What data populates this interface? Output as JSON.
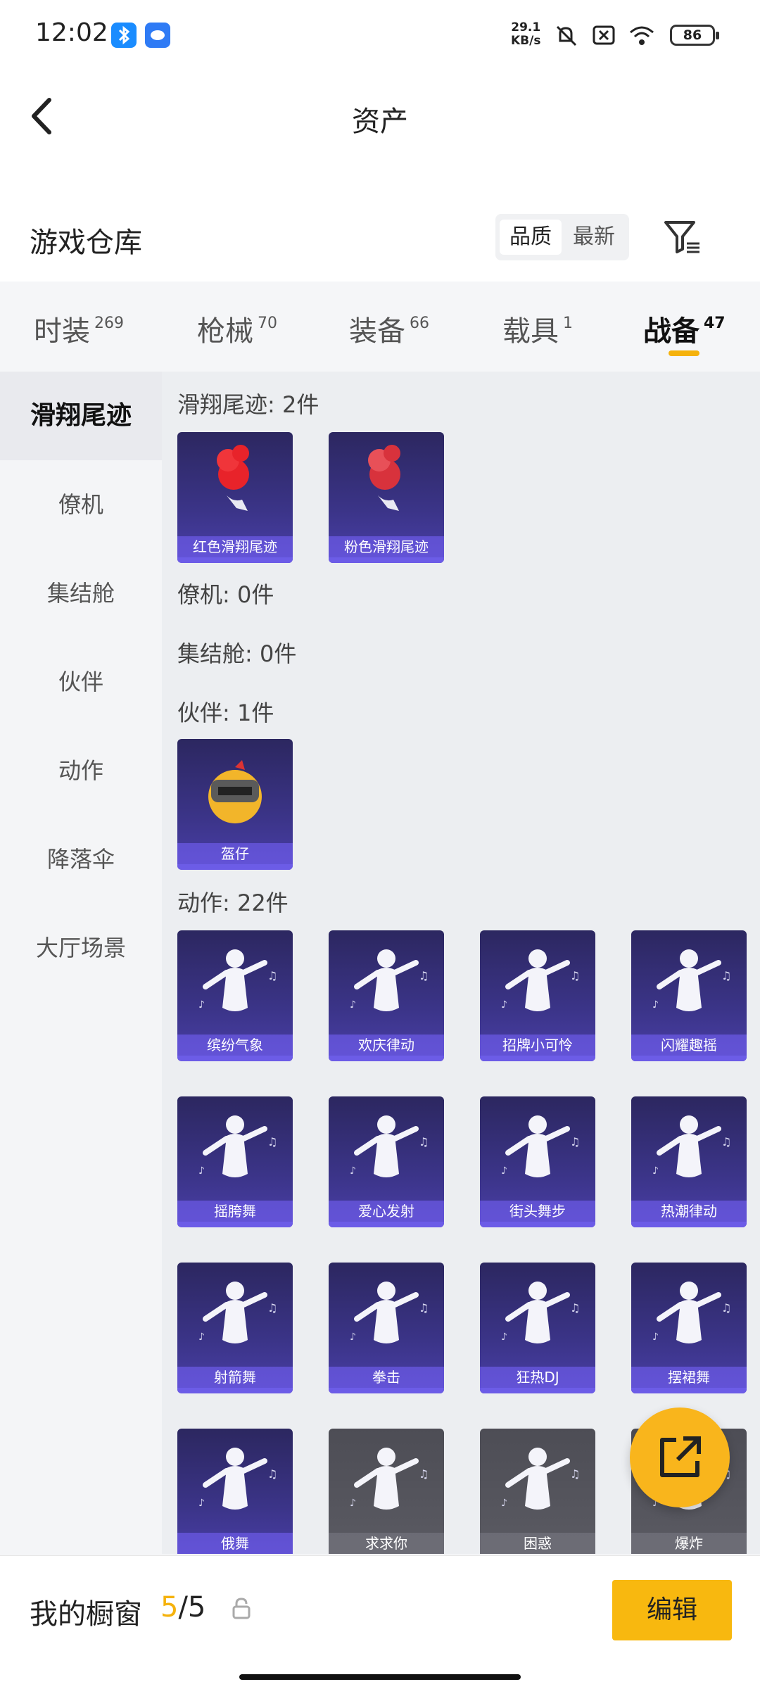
{
  "status_bar": {
    "time": "12:02",
    "net_speed_value": "29.1",
    "net_speed_unit": "KB/s",
    "battery": "86"
  },
  "nav": {
    "title": "资产"
  },
  "header": {
    "title": "游戏仓库",
    "sort_quality": "品质",
    "sort_newest": "最新"
  },
  "tabs": [
    {
      "label": "时装",
      "count": "269"
    },
    {
      "label": "枪械",
      "count": "70"
    },
    {
      "label": "装备",
      "count": "66"
    },
    {
      "label": "载具",
      "count": "1"
    },
    {
      "label": "战备",
      "count": "47"
    }
  ],
  "sidebar": [
    "滑翔尾迹",
    "僚机",
    "集结舱",
    "伙伴",
    "动作",
    "降落伞",
    "大厅场景"
  ],
  "groups": {
    "glide_trail": "滑翔尾迹: 2件",
    "wingman": "僚机: 0件",
    "pod": "集结舱: 0件",
    "partner": "伙伴: 1件",
    "emote": "动作: 22件"
  },
  "items": {
    "glide": [
      "红色滑翔尾迹",
      "粉色滑翔尾迹"
    ],
    "partner": [
      "盔仔"
    ],
    "emote": [
      "缤纷气象",
      "欢庆律动",
      "招牌小可怜",
      "闪耀趣摇",
      "摇胯舞",
      "爱心发射",
      "街头舞步",
      "热潮律动",
      "射箭舞",
      "拳击",
      "狂热DJ",
      "摆裙舞",
      "俄舞",
      "求求你",
      "困惑",
      "爆炸"
    ]
  },
  "bottom": {
    "label": "我的橱窗",
    "current": "5",
    "total": "/5",
    "edit": "编辑"
  },
  "colors": {
    "accent": "#f5b20c",
    "card_purple": "#3b3488"
  }
}
